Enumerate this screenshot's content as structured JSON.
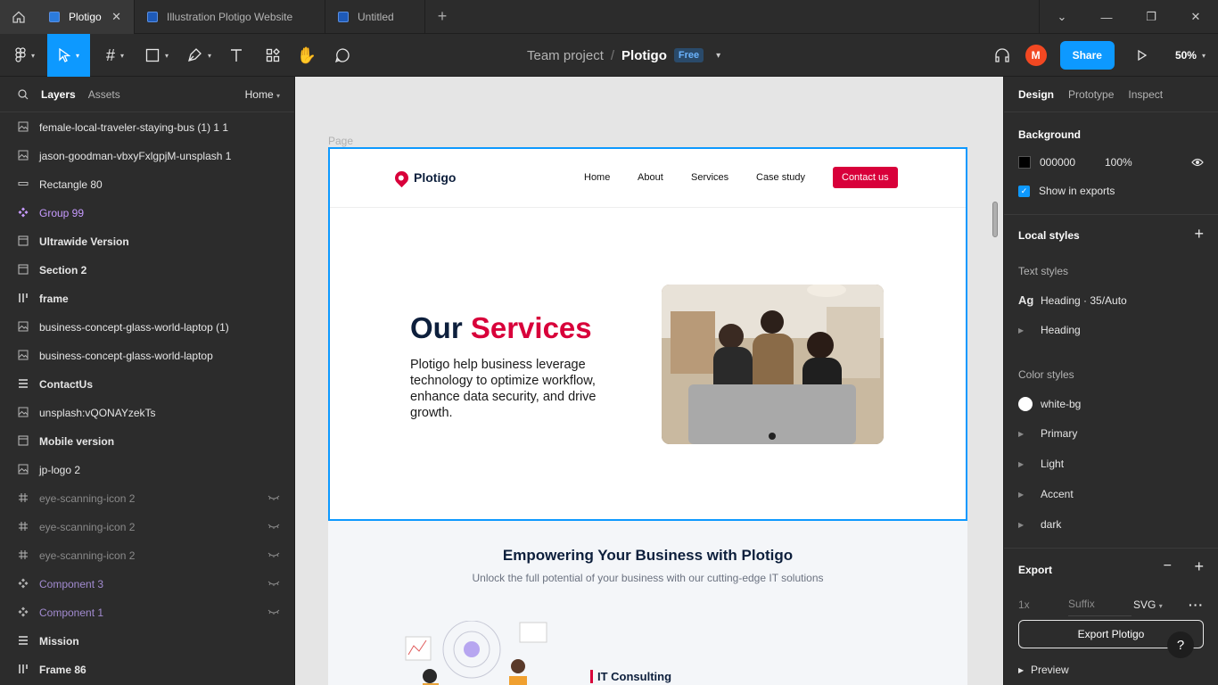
{
  "tabs": [
    {
      "label": "Plotigo",
      "active": true
    },
    {
      "label": "Illustration Plotigo Website",
      "active": false
    },
    {
      "label": "Untitled",
      "active": false
    }
  ],
  "toolbar": {
    "project": "Team project",
    "separator": "/",
    "file": "Plotigo",
    "plan_badge": "Free",
    "avatar_initial": "M",
    "share_label": "Share",
    "zoom": "50%"
  },
  "left_panel": {
    "tab_layers": "Layers",
    "tab_assets": "Assets",
    "page": "Home",
    "layers": [
      {
        "name": "female-local-traveler-staying-bus (1) 1 1",
        "icon": "image-icon",
        "style": "normal"
      },
      {
        "name": "jason-goodman-vbxyFxlgpjM-unsplash 1",
        "icon": "image-icon",
        "style": "normal"
      },
      {
        "name": "Rectangle 80",
        "icon": "rectangle-icon",
        "style": "normal"
      },
      {
        "name": "Group 99",
        "icon": "component-icon",
        "style": "purple"
      },
      {
        "name": "Ultrawide Version",
        "icon": "frame-icon",
        "style": "bold"
      },
      {
        "name": "Section 2",
        "icon": "frame-icon",
        "style": "bold"
      },
      {
        "name": "frame",
        "icon": "columns-icon",
        "style": "bold"
      },
      {
        "name": "business-concept-glass-world-laptop (1)",
        "icon": "image-icon",
        "style": "normal"
      },
      {
        "name": "business-concept-glass-world-laptop",
        "icon": "image-icon",
        "style": "normal"
      },
      {
        "name": "ContactUs",
        "icon": "rows-icon",
        "style": "bold"
      },
      {
        "name": "unsplash:vQONAYzekTs",
        "icon": "image-icon",
        "style": "normal"
      },
      {
        "name": "Mobile version",
        "icon": "frame-icon",
        "style": "bold"
      },
      {
        "name": "jp-logo 2",
        "icon": "image-icon",
        "style": "normal"
      },
      {
        "name": "eye-scanning-icon 2",
        "icon": "hash-icon",
        "style": "dim"
      },
      {
        "name": "eye-scanning-icon 2",
        "icon": "hash-icon",
        "style": "dim"
      },
      {
        "name": "eye-scanning-icon 2",
        "icon": "hash-icon",
        "style": "dim"
      },
      {
        "name": "Component 3",
        "icon": "component-icon",
        "style": "dim-purple"
      },
      {
        "name": "Component 1",
        "icon": "component-icon",
        "style": "dim-purple"
      },
      {
        "name": "Mission",
        "icon": "rows-icon",
        "style": "bold"
      },
      {
        "name": "Frame 86",
        "icon": "columns-icon",
        "style": "bold"
      }
    ]
  },
  "canvas": {
    "page_label": "Page",
    "site": {
      "brand": "Plotigo",
      "nav": [
        "Home",
        "About",
        "Services",
        "Case study"
      ],
      "cta": "Contact us",
      "hero_title_part1": "Our",
      "hero_title_part2": "Services",
      "hero_desc": "Plotigo help business leverage technology to optimize workflow, enhance data security, and drive growth.",
      "section_title": "Empowering Your Business with Plotigo",
      "section_sub": "Unlock the full potential of your business with our cutting-edge IT solutions",
      "service_title": "IT Consulting"
    }
  },
  "right_panel": {
    "tab_design": "Design",
    "tab_prototype": "Prototype",
    "tab_inspect": "Inspect",
    "background_title": "Background",
    "bg_hex": "000000",
    "bg_opacity": "100%",
    "show_exports": "Show in exports",
    "local_styles": "Local styles",
    "text_styles": "Text styles",
    "text_style_ag": "Ag",
    "text_style_name": "Heading · 35/Auto",
    "text_group": "Heading",
    "color_styles": "Color styles",
    "colors": [
      "white-bg",
      "Primary",
      "Light",
      "Accent",
      "dark"
    ],
    "export_title": "Export",
    "export_scale": "1x",
    "export_suffix": "Suffix",
    "export_format": "SVG",
    "export_button": "Export Plotigo",
    "preview": "Preview",
    "help": "?"
  },
  "colors": {
    "accent": "#0d99ff",
    "brand_red": "#d8003a",
    "navy": "#0d1f3c"
  }
}
